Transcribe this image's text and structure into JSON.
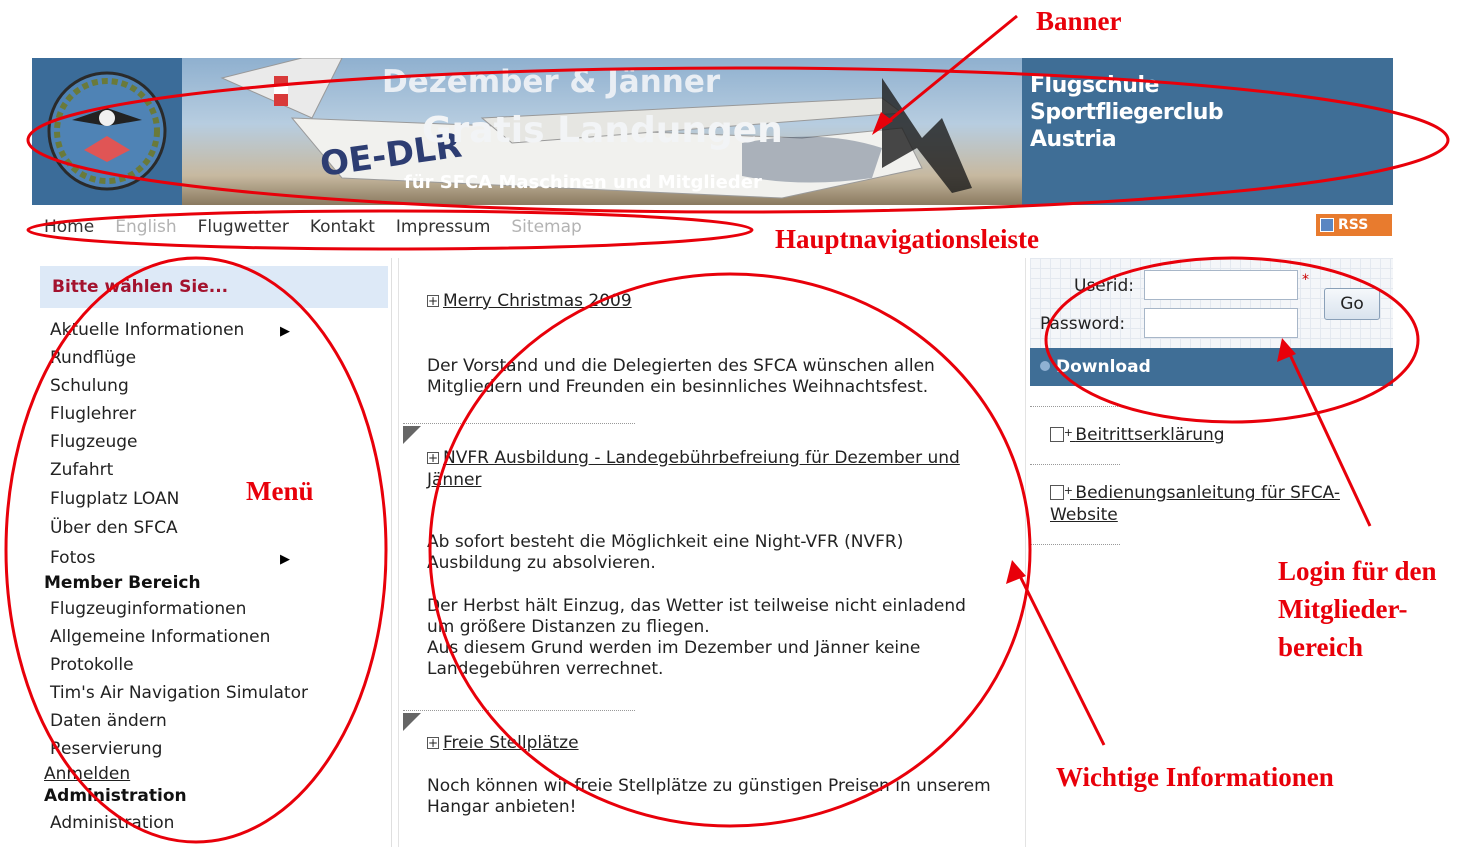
{
  "banner": {
    "line1": "Dezember  &  Jänner",
    "line2": "Gratis Landungen",
    "line3": "für SFCA Maschinen und Mitglieder",
    "registration": "OE-DLR",
    "org_line1": "Flugschule",
    "org_line2": "Sportfliegerclub",
    "org_line3": "Austria"
  },
  "nav": {
    "items": [
      {
        "label": "Home",
        "active": true
      },
      {
        "label": "English",
        "active": false
      },
      {
        "label": "Flugwetter",
        "active": true
      },
      {
        "label": "Kontakt",
        "active": true
      },
      {
        "label": "Impressum",
        "active": true
      },
      {
        "label": "Sitemap",
        "active": false
      }
    ],
    "rss_label": "RSS"
  },
  "menu": {
    "heading": "Bitte wählen Sie...",
    "items": [
      "Aktuelle Informationen",
      "Rundflüge",
      "Schulung",
      "Fluglehrer",
      "Flugzeuge",
      "Zufahrt",
      "Flugplatz LOAN",
      "Über den SFCA",
      "Fotos"
    ],
    "member_section": "Member Bereich",
    "member_items": [
      "Flugzeuginformationen",
      "Allgemeine Informationen",
      "Protokolle",
      "Tim's Air Navigation Simulator",
      "Daten ändern",
      "Reservierung"
    ],
    "login_link": "Anmelden",
    "admin_section": "Administration",
    "admin_item": "Administration"
  },
  "news": [
    {
      "title": "Merry Christmas 2009",
      "body": [
        "Der Vorstand und die Delegierten des SFCA wünschen allen Mitgliedern und Freunden ein besinnliches Weihnachtsfest."
      ]
    },
    {
      "title": "NVFR Ausbildung - Landegebührbefreiung für Dezember und Jänner",
      "body": [
        "Ab sofort besteht die Möglichkeit eine Night-VFR (NVFR) Ausbildung zu absolvieren.",
        "Der Herbst hält Einzug, das Wetter ist teilweise nicht einladend um größere Distanzen zu fliegen.",
        "Aus diesem Grund werden im Dezember und Jänner keine Landegebühren verrechnet."
      ]
    },
    {
      "title": "Freie Stellplätze",
      "body": [
        "Noch können wir freie Stellplätze zu günstigen Preisen in unserem Hangar anbieten!"
      ]
    }
  ],
  "login": {
    "userid_label": "Userid:",
    "password_label": "Password:",
    "userid_value": "",
    "password_value": "",
    "required_mark": "*",
    "go_label": "Go"
  },
  "download": {
    "heading": "Download",
    "links": [
      "Beitrittserklärung",
      "Bedienungsanleitung für SFCA-Website"
    ]
  },
  "annotations": {
    "banner": "Banner",
    "nav": "Hauptnavigationsleiste",
    "menu": "Menü",
    "login_l1": "Login für den",
    "login_l2": "Mitglieder-",
    "login_l3": "bereich",
    "content": "Wichtige Informationen"
  },
  "colors": {
    "banner_blue": "#3f6e96",
    "menu_heading": "#a3122e",
    "annotation_red": "#e8000a",
    "rss_orange": "#e87b2e"
  }
}
